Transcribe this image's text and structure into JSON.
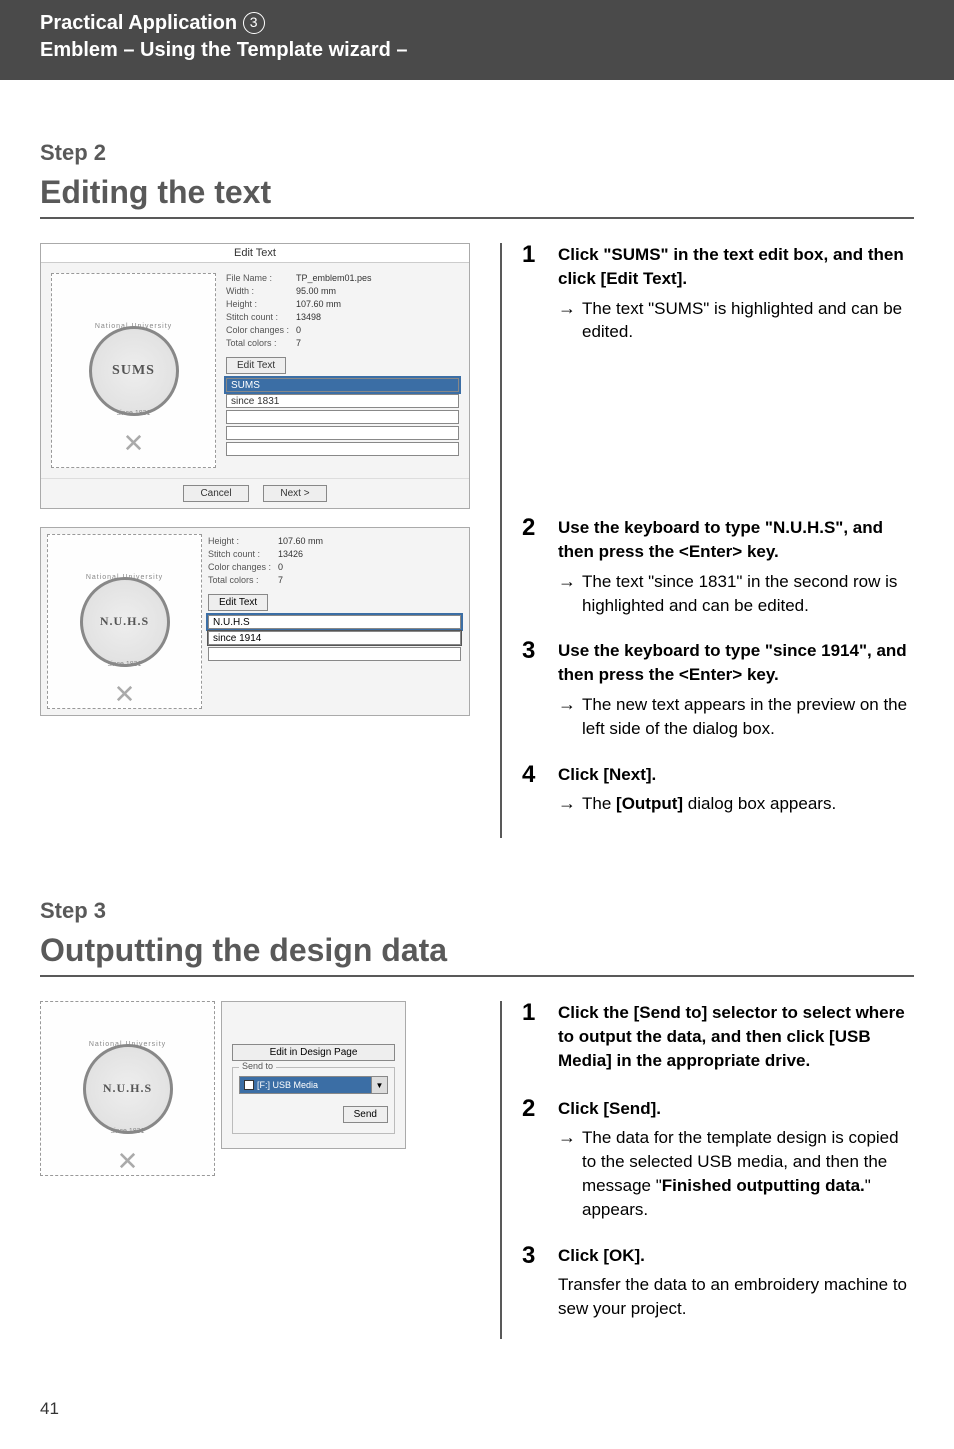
{
  "header": {
    "line1_prefix": "Practical Application ",
    "line1_num": "3",
    "line2": "Emblem – Using the Template wizard –"
  },
  "step2": {
    "label": "Step 2",
    "title": "Editing the text",
    "dialog1": {
      "title": "Edit Text",
      "emblem_text": "SUMS",
      "emblem_arc_top": "National University",
      "emblem_arc_bot": "since 1831",
      "info": {
        "file_name_label": "File Name :",
        "file_name": "TP_emblem01.pes",
        "width_label": "Width :",
        "width": "95.00  mm",
        "height_label": "Height :",
        "height": "107.60  mm",
        "stitch_label": "Stitch count :",
        "stitch": "13498",
        "color_changes_label": "Color changes :",
        "color_changes": "0",
        "total_colors_label": "Total colors :",
        "total_colors": "7"
      },
      "edit_btn": "Edit Text",
      "field1": "SUMS",
      "field2": "since 1831",
      "cancel": "Cancel",
      "next": "Next >"
    },
    "dialog2": {
      "emblem_text": "N.U.H.S",
      "info": {
        "height_label": "Height :",
        "height": "107.60  mm",
        "stitch_label": "Stitch count :",
        "stitch": "13426",
        "color_changes_label": "Color changes :",
        "color_changes": "0",
        "total_colors_label": "Total colors :",
        "total_colors": "7"
      },
      "edit_btn": "Edit Text",
      "field1": "N.U.H.S",
      "field2": "since 1914"
    },
    "items": {
      "i1": {
        "num": "1",
        "instr": "Click \"SUMS\" in the text edit box, and then click [Edit Text].",
        "arrow": "The text \"SUMS\" is highlighted and can be edited."
      },
      "i2": {
        "num": "2",
        "instr": "Use the keyboard to type \"N.U.H.S\", and then press the <Enter> key.",
        "arrow": "The text \"since 1831\" in the second row is highlighted and can be edited."
      },
      "i3": {
        "num": "3",
        "instr": "Use the keyboard to type \"since 1914\", and then press the <Enter> key.",
        "arrow": "The new text appears in the preview on the left side of the dialog box."
      },
      "i4": {
        "num": "4",
        "instr": "Click [Next].",
        "arrow_pre": "The ",
        "arrow_bold": "[Output]",
        "arrow_post": " dialog box appears."
      }
    }
  },
  "step3": {
    "label": "Step 3",
    "title": "Outputting the design data",
    "panel": {
      "emblem_text": "N.U.H.S",
      "edit_in_dp": "Edit in Design Page",
      "send_to_label": "Send to",
      "combo": "[F:] USB Media",
      "send": "Send"
    },
    "items": {
      "i1": {
        "num": "1",
        "instr": "Click the [Send to] selector to select where to output the data, and then click [USB Media] in the appropriate drive."
      },
      "i2": {
        "num": "2",
        "instr": "Click [Send].",
        "arrow_pre": "The data for the template design is copied to the selected USB media, and then the message \"",
        "arrow_bold": "Finished outputting data.",
        "arrow_post": "\" appears."
      },
      "i3": {
        "num": "3",
        "instr": "Click [OK].",
        "sub": "Transfer the data to an embroidery machine to sew your project."
      }
    }
  },
  "page_num": "41"
}
